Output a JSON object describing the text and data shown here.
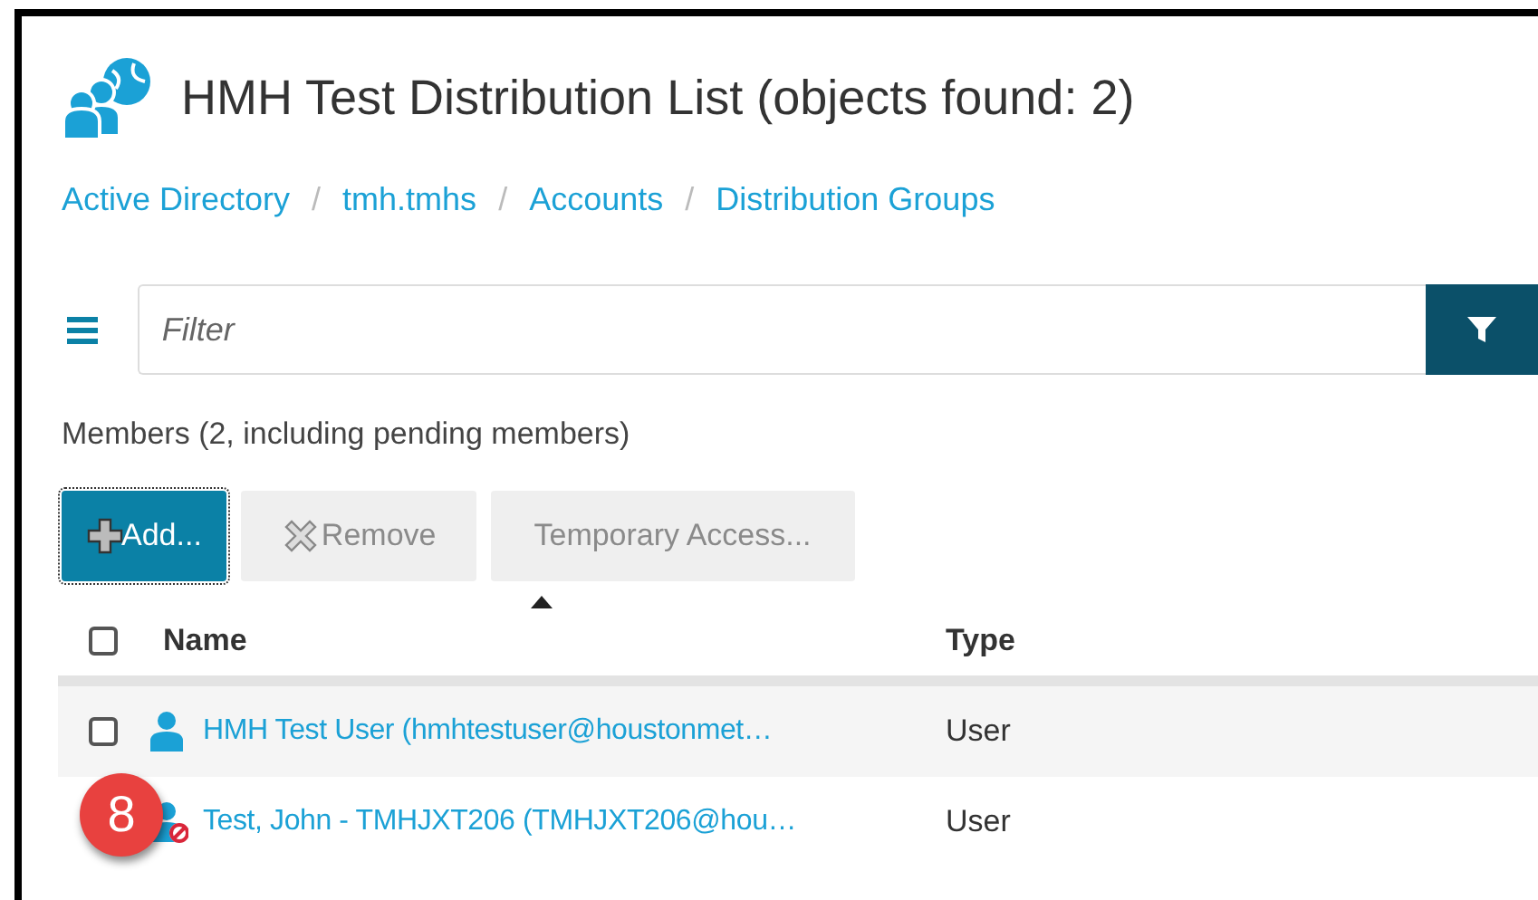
{
  "title": "HMH Test Distribution List  (objects found: 2)",
  "breadcrumb": [
    {
      "label": "Active Directory"
    },
    {
      "separator": "/",
      "label": "tmh.tmhs"
    },
    {
      "separator": "/",
      "label": "Accounts"
    },
    {
      "separator": "/",
      "label": "Distribution Groups"
    }
  ],
  "filter": {
    "placeholder": "Filter"
  },
  "members_label": "Members (2, including pending members)",
  "buttons": [
    {
      "label": "Add...",
      "kind": "add",
      "disabled": false
    },
    {
      "label": "Remove",
      "kind": "remove",
      "disabled": true
    },
    {
      "label": "Temporary Access...",
      "kind": "plain",
      "disabled": true
    }
  ],
  "table": {
    "select_all": {
      "checked": false
    },
    "columns": [
      {
        "label": "Name",
        "sorted": true
      },
      {
        "label": "Type",
        "sorted": false
      }
    ],
    "rows": [
      {
        "checked": false,
        "kind": "user",
        "name": "HMH Test User (hmhtestuser@houstonmet…",
        "type": "User"
      },
      {
        "kind": "blocked-user",
        "name": "Test, John - TMHJXT206 (TMHJXT206@hou…",
        "type": "User",
        "callout": "8"
      }
    ]
  }
}
